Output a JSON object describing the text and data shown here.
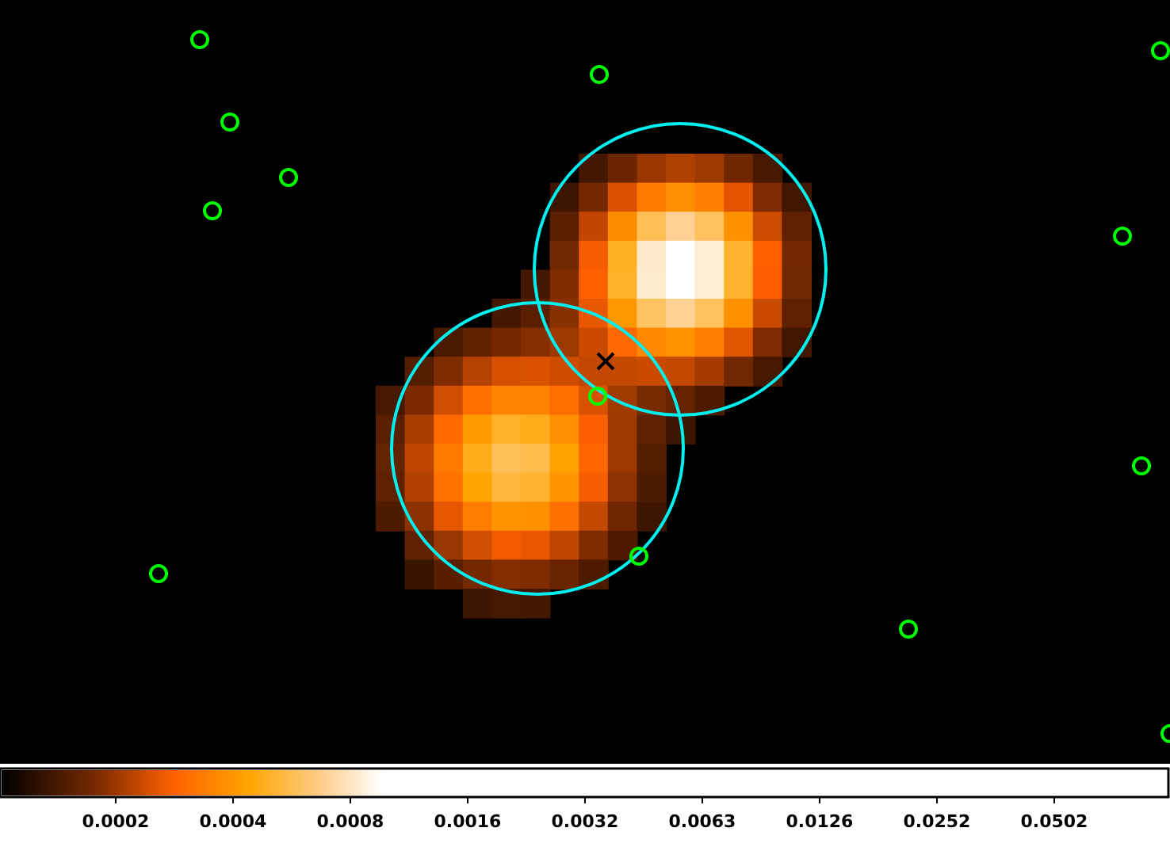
{
  "colorbar": {
    "tick_labels": [
      "0.0002",
      "0.0004",
      "0.0008",
      "0.0016",
      "0.0032",
      "0.0063",
      "0.0126",
      "0.0252",
      "0.0502"
    ]
  }
}
